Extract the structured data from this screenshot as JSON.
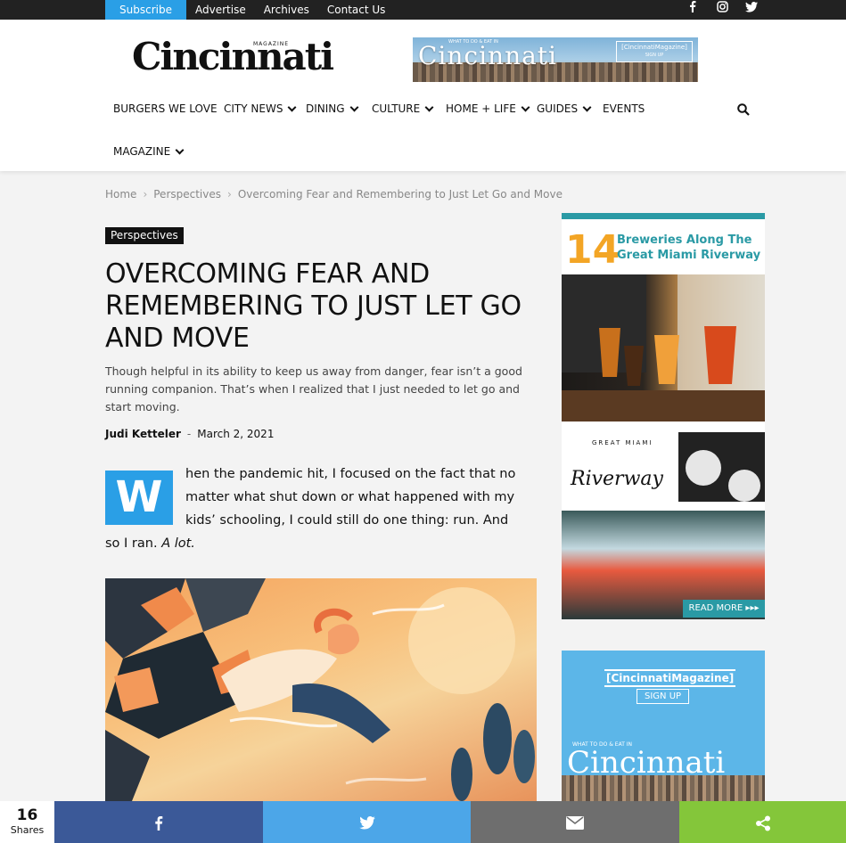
{
  "topbar": {
    "subscribe": "Subscribe",
    "links": [
      "Advertise",
      "Archives",
      "Contact Us"
    ],
    "social": [
      "facebook-icon",
      "instagram-icon",
      "twitter-icon"
    ]
  },
  "header": {
    "logo_small": "MAGAZINE",
    "logo": "Cincinnati",
    "ad": {
      "tagline": "WHAT TO DO & EAT IN",
      "word": "Cincinnati",
      "brand": "[CincinnatiMagazine]",
      "cta": "SIGN UP"
    }
  },
  "nav": {
    "items": [
      {
        "label": "BURGERS WE LOVE",
        "dropdown": false
      },
      {
        "label": "CITY NEWS",
        "dropdown": true
      },
      {
        "label": "DINING",
        "dropdown": true
      },
      {
        "label": "CULTURE",
        "dropdown": true
      },
      {
        "label": "HOME + LIFE",
        "dropdown": true
      },
      {
        "label": "GUIDES",
        "dropdown": true
      },
      {
        "label": "EVENTS",
        "dropdown": false
      },
      {
        "label": "MAGAZINE",
        "dropdown": true
      }
    ]
  },
  "breadcrumb": {
    "items": [
      "Home",
      "Perspectives",
      "Overcoming Fear and Remembering to Just Let Go and Move"
    ]
  },
  "article": {
    "category": "Perspectives",
    "title": "OVERCOMING FEAR AND REMEMBERING TO JUST LET GO AND MOVE",
    "excerpt": "Though helpful in its ability to keep us away from danger, fear isn’t a good running companion. That’s when I realized that I just needed to let go and start moving.",
    "author": "Judi Ketteler",
    "date": "March 2, 2021",
    "dropcap": "W",
    "body_lines": [
      "hen the pandemic hit, I focused on the fact that no",
      "matter what shut down or what happened with my",
      "kids’ schooling, I could still do one thing: run. And"
    ],
    "body_last": "so I ran.",
    "body_last_em": "A lot."
  },
  "sidebar": {
    "ad1": {
      "number": "14",
      "headline": "Breweries Along The Great Miami Riverway",
      "logo_top": "GREAT MIAMI",
      "logo_script": "Riverway",
      "cta": "READ MORE ▸▸▸"
    },
    "ad2": {
      "brand": "[CincinnatiMagazine]",
      "cta": "SIGN UP",
      "tagline": "WHAT TO DO & EAT IN",
      "word": "Cincinnati"
    }
  },
  "share": {
    "count": "16",
    "label": "Shares",
    "buttons": [
      {
        "name": "facebook",
        "color": "#3b5998",
        "glyph": "f"
      },
      {
        "name": "twitter",
        "color": "#4ca6e8",
        "glyph": "🐦"
      },
      {
        "name": "email",
        "color": "#6e6e6e",
        "glyph": "✉"
      },
      {
        "name": "sharethis",
        "color": "#84c63a",
        "glyph": "⟨"
      }
    ]
  }
}
